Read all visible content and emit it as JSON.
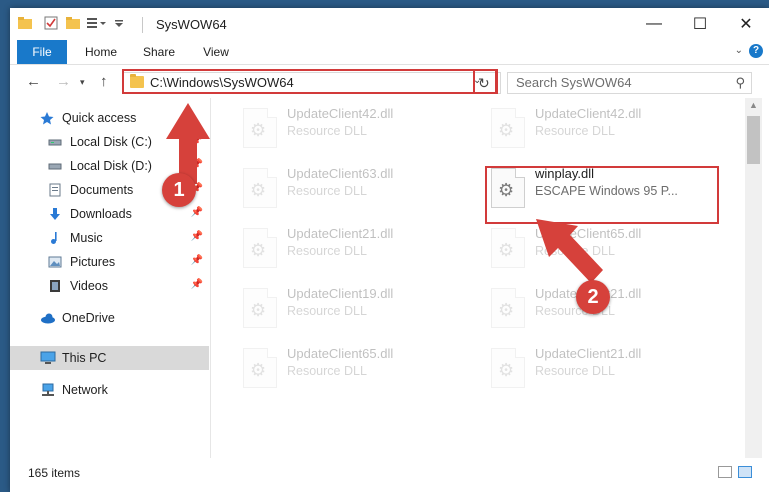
{
  "window": {
    "title": "SysWOW64"
  },
  "ribbon": {
    "tabs": [
      "File",
      "Home",
      "Share",
      "View"
    ],
    "help": "?"
  },
  "address": {
    "path": "C:\\Windows\\SysWOW64"
  },
  "search": {
    "placeholder": "Search SysWOW64"
  },
  "nav": {
    "quick_access": "Quick access",
    "items": [
      "Local Disk (C:)",
      "Local Disk (D:)",
      "Documents",
      "Downloads",
      "Music",
      "Pictures",
      "Videos"
    ],
    "onedrive": "OneDrive",
    "this_pc": "This PC",
    "network": "Network"
  },
  "files": {
    "col1": [
      {
        "name": "UpdateClient42.dll",
        "desc": "Resource DLL"
      },
      {
        "name": "UpdateClient63.dll",
        "desc": "Resource DLL"
      },
      {
        "name": "UpdateClient21.dll",
        "desc": "Resource DLL"
      },
      {
        "name": "UpdateClient19.dll",
        "desc": "Resource DLL"
      },
      {
        "name": "UpdateClient65.dll",
        "desc": "Resource DLL"
      }
    ],
    "col2": [
      {
        "name": "UpdateClient42.dll",
        "desc": "Resource DLL"
      },
      {
        "name": "winplay.dll",
        "desc": "ESCAPE Windows 95 P..."
      },
      {
        "name": "UpdateClient65.dll",
        "desc": "Resource DLL"
      },
      {
        "name": "UpdateClient21.dll",
        "desc": "Resource DLL"
      },
      {
        "name": "UpdateClient21.dll",
        "desc": "Resource DLL"
      }
    ]
  },
  "status": {
    "items": "165 items"
  },
  "annotations": {
    "step1": "1",
    "step2": "2",
    "color": "#d6413b"
  }
}
